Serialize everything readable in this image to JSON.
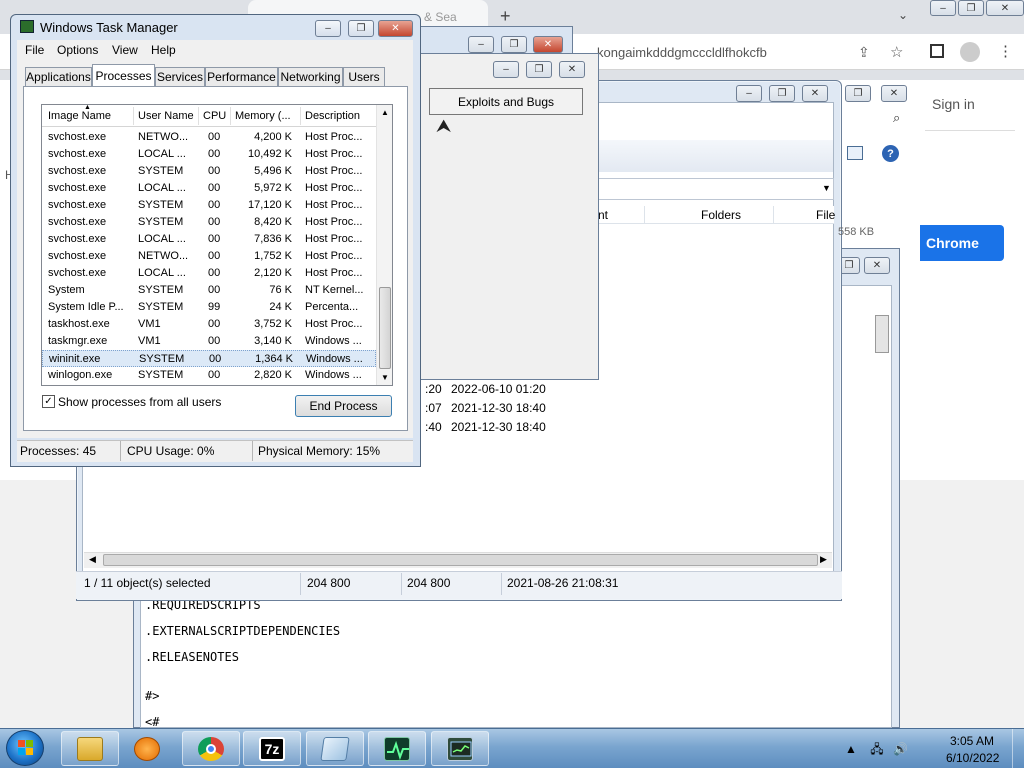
{
  "chrome": {
    "tab_fragment": "& Sea",
    "new_tab": "+",
    "url_fragment": "kongaimkdddgmcccldlfhokcfb",
    "sign_in": "Sign in",
    "chrome_button": "Chrome",
    "size_label": "558 KB"
  },
  "exploits_window": {
    "button_label": "Exploits and Bugs"
  },
  "explorer": {
    "columns": [
      "nt",
      "Folders",
      "File"
    ],
    "rows": [
      {
        "time_partial": ":20",
        "date": "2022-06-10 01:20"
      },
      {
        "time_partial": ":07",
        "date": "2021-12-30 18:40"
      },
      {
        "time_partial": ":40",
        "date": "2021-12-30 18:40"
      }
    ],
    "status": {
      "selected": "1 / 11 object(s) selected",
      "size1": "204 800",
      "size2": "204 800",
      "modified": "2021-08-26 21:08:31"
    }
  },
  "text_window": {
    "lines": [
      ".REQUIREDSCRIPTS",
      ".EXTERNALSCRIPTDEPENDENCIES",
      ".RELEASENOTES",
      "#>",
      "<#"
    ]
  },
  "taskmgr": {
    "title": "Windows Task Manager",
    "menu": [
      "File",
      "Options",
      "View",
      "Help"
    ],
    "tabs": [
      "Applications",
      "Processes",
      "Services",
      "Performance",
      "Networking",
      "Users"
    ],
    "active_tab": "Processes",
    "columns": [
      "Image Name",
      "User Name",
      "CPU",
      "Memory (...",
      "Description"
    ],
    "processes": [
      {
        "name": "svchost.exe",
        "user": "NETWO...",
        "cpu": "00",
        "mem": "4,200 K",
        "desc": "Host Proc..."
      },
      {
        "name": "svchost.exe",
        "user": "LOCAL ...",
        "cpu": "00",
        "mem": "10,492 K",
        "desc": "Host Proc..."
      },
      {
        "name": "svchost.exe",
        "user": "SYSTEM",
        "cpu": "00",
        "mem": "5,496 K",
        "desc": "Host Proc..."
      },
      {
        "name": "svchost.exe",
        "user": "LOCAL ...",
        "cpu": "00",
        "mem": "5,972 K",
        "desc": "Host Proc..."
      },
      {
        "name": "svchost.exe",
        "user": "SYSTEM",
        "cpu": "00",
        "mem": "17,120 K",
        "desc": "Host Proc..."
      },
      {
        "name": "svchost.exe",
        "user": "SYSTEM",
        "cpu": "00",
        "mem": "8,420 K",
        "desc": "Host Proc..."
      },
      {
        "name": "svchost.exe",
        "user": "LOCAL ...",
        "cpu": "00",
        "mem": "7,836 K",
        "desc": "Host Proc..."
      },
      {
        "name": "svchost.exe",
        "user": "NETWO...",
        "cpu": "00",
        "mem": "1,752 K",
        "desc": "Host Proc..."
      },
      {
        "name": "svchost.exe",
        "user": "LOCAL ...",
        "cpu": "00",
        "mem": "2,120 K",
        "desc": "Host Proc..."
      },
      {
        "name": "System",
        "user": "SYSTEM",
        "cpu": "00",
        "mem": "76 K",
        "desc": "NT Kernel..."
      },
      {
        "name": "System Idle P...",
        "user": "SYSTEM",
        "cpu": "99",
        "mem": "24 K",
        "desc": "Percenta..."
      },
      {
        "name": "taskhost.exe",
        "user": "VM1",
        "cpu": "00",
        "mem": "3,752 K",
        "desc": "Host Proc..."
      },
      {
        "name": "taskmgr.exe",
        "user": "VM1",
        "cpu": "00",
        "mem": "3,140 K",
        "desc": "Windows ..."
      },
      {
        "name": "wininit.exe",
        "user": "SYSTEM",
        "cpu": "00",
        "mem": "1,364 K",
        "desc": "Windows ...",
        "selected": true
      },
      {
        "name": "winlogon.exe",
        "user": "SYSTEM",
        "cpu": "00",
        "mem": "2,820 K",
        "desc": "Windows ..."
      }
    ],
    "show_all_label": "Show processes from all users",
    "show_all_checked": true,
    "end_process_label": "End Process",
    "status": {
      "processes": "Processes: 45",
      "cpu": "CPU Usage: 0%",
      "memory": "Physical Memory: 15%"
    }
  },
  "taskbar": {
    "time": "3:05 AM",
    "date": "6/10/2022",
    "items": [
      "explorer-icon",
      "media-player-icon",
      "chrome-icon",
      "7zip-icon",
      "notepad-icon",
      "task-manager-icon",
      "network-monitor-icon"
    ]
  },
  "colors": {
    "chrome_blue": "#1a73e8",
    "selection": "#dce9f7",
    "taskbar": "#7aa5cf"
  }
}
